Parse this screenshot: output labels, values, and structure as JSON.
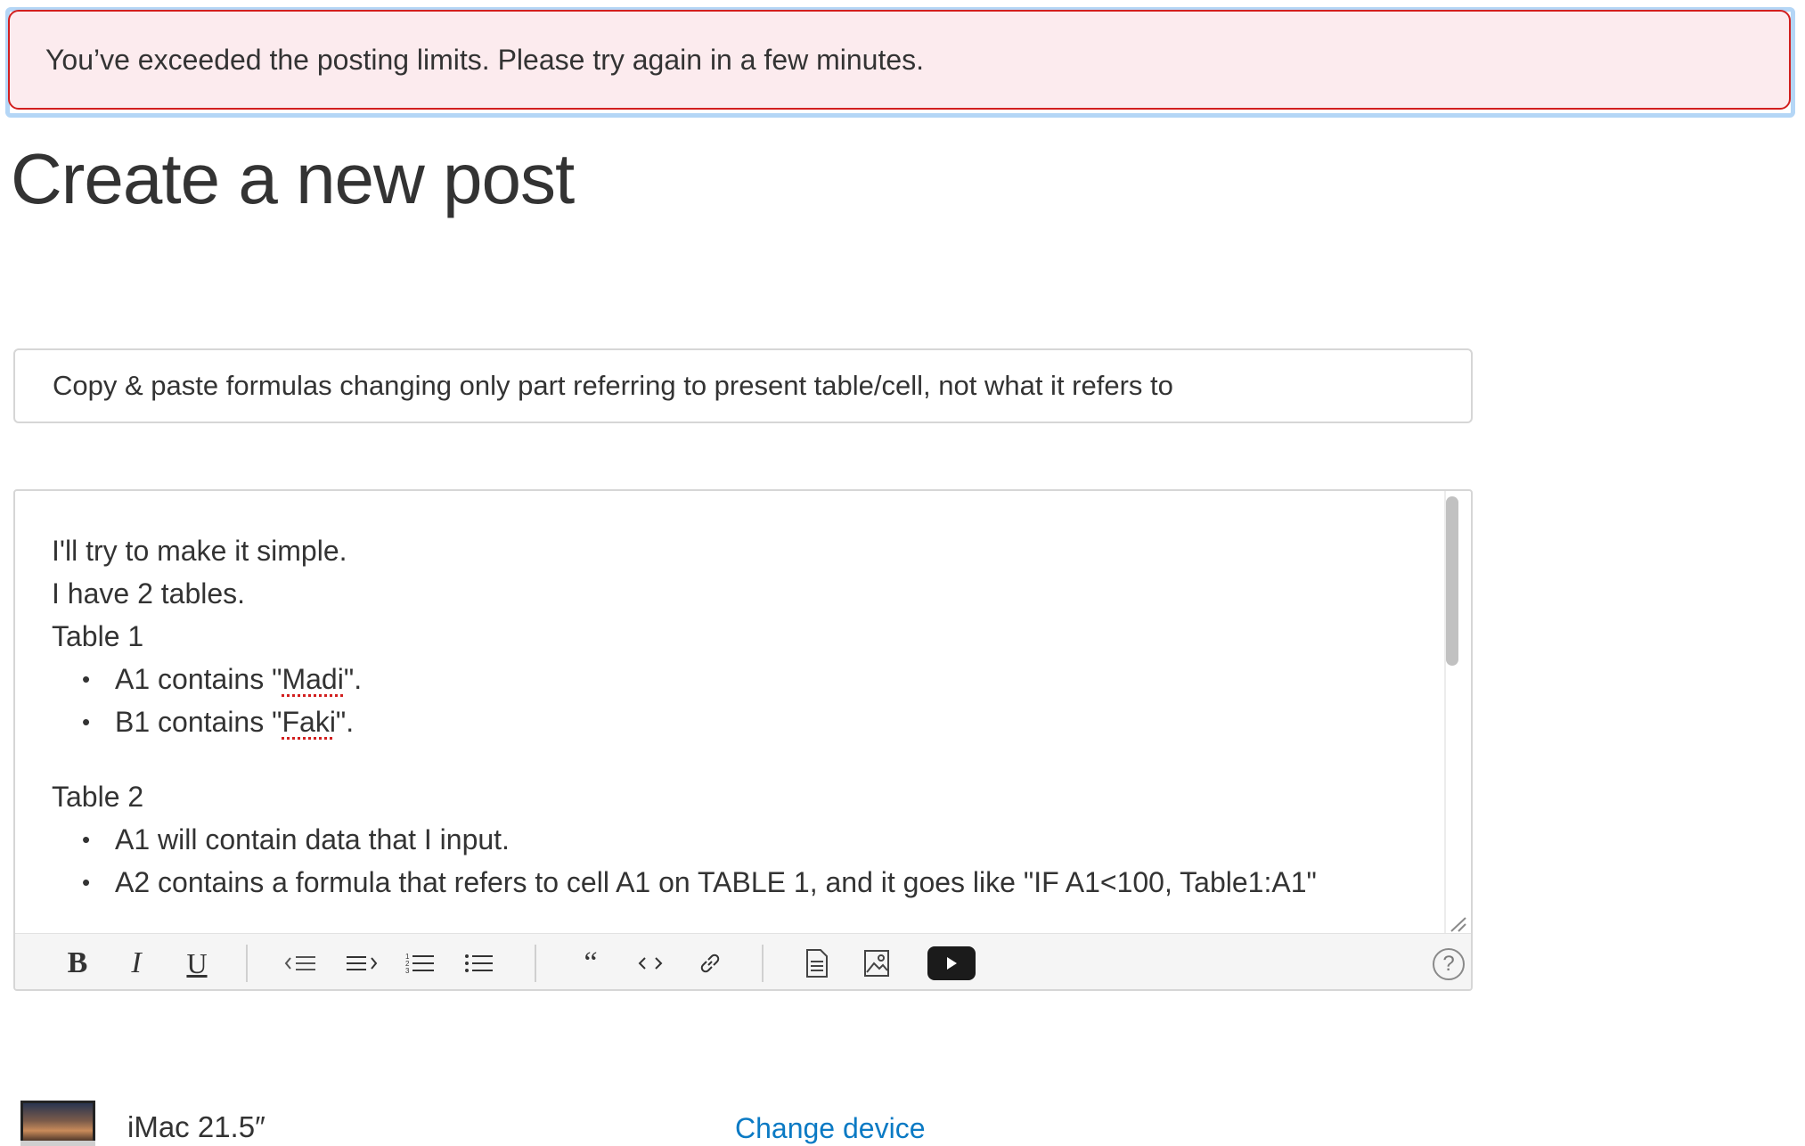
{
  "alert": {
    "message": "You’ve exceeded the posting limits. Please try again in a few minutes."
  },
  "page": {
    "title": "Create a new post"
  },
  "subject": {
    "value": "Copy & paste formulas changing only part referring to present table/cell, not what it refers to"
  },
  "editor": {
    "line1": "I'll try to make it simple.",
    "line2": "I have 2 tables.",
    "table1_heading": "Table 1",
    "table1_item1_prefix": "A1 contains \"",
    "table1_item1_word": "Madi",
    "table1_item1_suffix": "\".",
    "table1_item2_prefix": "B1 contains \"",
    "table1_item2_word": "Faki",
    "table1_item2_suffix": "\".",
    "table2_heading": "Table 2",
    "table2_item1": "A1 will contain data that I input.",
    "table2_item2": "A2 contains a formula that refers to cell A1 on TABLE 1, and it goes like \"IF A1<100, Table1:A1\""
  },
  "toolbar": {
    "bold": "B",
    "italic": "I",
    "underline": "U",
    "quote": "“",
    "help": "?"
  },
  "device": {
    "name": "iMac 21.5″",
    "change_label": "Change device"
  }
}
